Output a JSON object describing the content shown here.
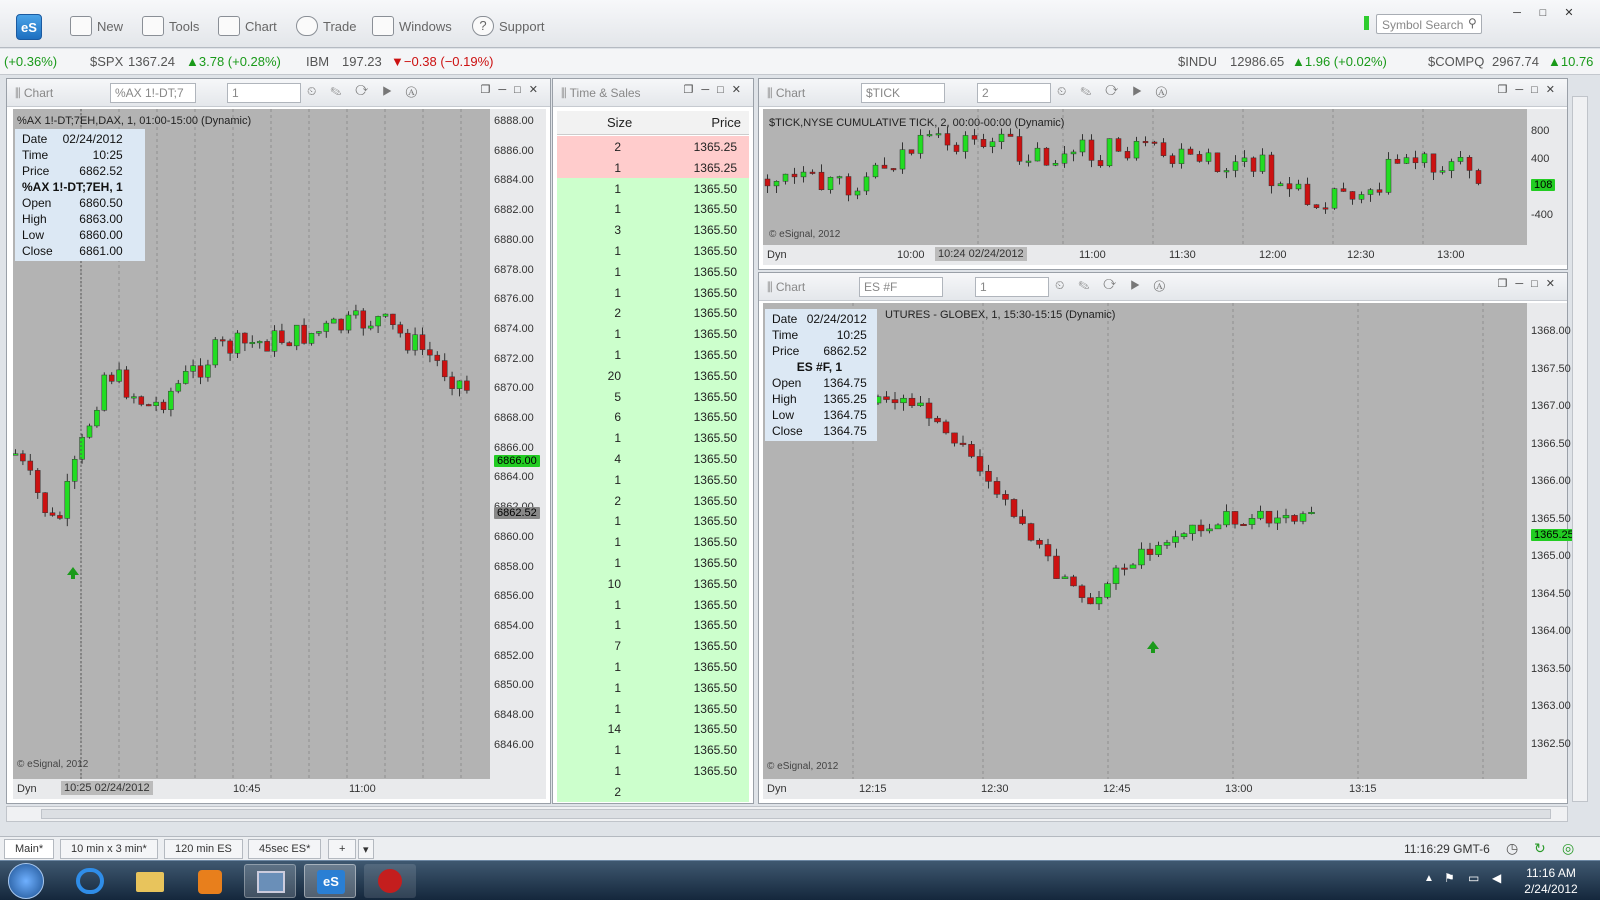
{
  "app": {
    "logo": "eS",
    "toolbar": [
      {
        "label": "New",
        "icon": "new-window-icon"
      },
      {
        "label": "Tools",
        "icon": "tools-icon"
      },
      {
        "label": "Chart",
        "icon": "chart-icon"
      },
      {
        "label": "Trade",
        "icon": "trade-icon"
      },
      {
        "label": "Windows",
        "icon": "windows-icon"
      },
      {
        "label": "Support",
        "icon": "help-icon"
      }
    ],
    "symbol_search_placeholder": "Symbol Search"
  },
  "ticker": [
    {
      "text": "(+0.36%)",
      "cls": "up"
    },
    {
      "sym": "$SPX",
      "price": "1367.24",
      "change": "▲3.78 (+0.28%)",
      "cls": "up"
    },
    {
      "sym": "IBM",
      "price": "197.23",
      "change": "▼−0.38 (−0.19%)",
      "cls": "dn"
    },
    {
      "sym": "$INDU",
      "price": "12986.65",
      "change": "▲1.96 (+0.02%)",
      "cls": "up"
    },
    {
      "sym": "$COMPQ",
      "price": "2967.74",
      "change": "▲10.76",
      "cls": "up"
    }
  ],
  "chart1": {
    "title": "Chart",
    "symbol": "%AX 1!-DT;7",
    "interval": "1",
    "caption": "%AX 1!-DT;7EH,DAX, 1, 01:00-15:00 (Dynamic)",
    "info": {
      "date": "02/24/2012",
      "time": "10:25",
      "price": "6862.52",
      "symbol": "%AX 1!-DT;7EH, 1",
      "open": "6860.50",
      "high": "6863.00",
      "low": "6860.00",
      "close": "6861.00"
    },
    "yticks": [
      "6888.00",
      "6886.00",
      "6884.00",
      "6882.00",
      "6880.00",
      "6878.00",
      "6876.00",
      "6874.00",
      "6872.00",
      "6870.00",
      "6868.00",
      "6866.00",
      "6864.00",
      "6862.00",
      "6860.00",
      "6858.00",
      "6856.00",
      "6854.00",
      "6852.00",
      "6850.00",
      "6848.00",
      "6846.00"
    ],
    "last_price": "6866.00",
    "cursor_price": "6862.52",
    "dyn": "Dyn",
    "cursor_time": "10:25 02/24/2012",
    "xticks": [
      "10:45",
      "11:00"
    ],
    "copyright": "© eSignal, 2012"
  },
  "ts": {
    "title": "Time & Sales",
    "col_size": "Size",
    "col_price": "Price",
    "rows": [
      [
        "2",
        "1365.25",
        "dn"
      ],
      [
        "1",
        "1365.25",
        "dn"
      ],
      [
        "1",
        "1365.50",
        "up"
      ],
      [
        "1",
        "1365.50",
        "up"
      ],
      [
        "3",
        "1365.50",
        "up"
      ],
      [
        "1",
        "1365.50",
        "up"
      ],
      [
        "1",
        "1365.50",
        "up"
      ],
      [
        "1",
        "1365.50",
        "up"
      ],
      [
        "2",
        "1365.50",
        "up"
      ],
      [
        "1",
        "1365.50",
        "up"
      ],
      [
        "1",
        "1365.50",
        "up"
      ],
      [
        "20",
        "1365.50",
        "up"
      ],
      [
        "5",
        "1365.50",
        "up"
      ],
      [
        "6",
        "1365.50",
        "up"
      ],
      [
        "1",
        "1365.50",
        "up"
      ],
      [
        "4",
        "1365.50",
        "up"
      ],
      [
        "1",
        "1365.50",
        "up"
      ],
      [
        "2",
        "1365.50",
        "up"
      ],
      [
        "1",
        "1365.50",
        "up"
      ],
      [
        "1",
        "1365.50",
        "up"
      ],
      [
        "1",
        "1365.50",
        "up"
      ],
      [
        "10",
        "1365.50",
        "up"
      ],
      [
        "1",
        "1365.50",
        "up"
      ],
      [
        "1",
        "1365.50",
        "up"
      ],
      [
        "7",
        "1365.50",
        "up"
      ],
      [
        "1",
        "1365.50",
        "up"
      ],
      [
        "1",
        "1365.50",
        "up"
      ],
      [
        "1",
        "1365.50",
        "up"
      ],
      [
        "14",
        "1365.50",
        "up"
      ],
      [
        "1",
        "1365.50",
        "up"
      ],
      [
        "1",
        "1365.50",
        "up"
      ],
      [
        "2",
        "",
        "up"
      ]
    ]
  },
  "chart2": {
    "title": "Chart",
    "symbol": "$TICK",
    "interval": "2",
    "caption": "$TICK,NYSE CUMULATIVE TICK, 2, 00:00-00:00 (Dynamic)",
    "yticks": [
      "800",
      "400",
      "0",
      "-400"
    ],
    "last": "108",
    "dyn": "Dyn",
    "cursor_time": "10:24 02/24/2012",
    "xticks": [
      "10:00",
      "11:00",
      "11:30",
      "12:00",
      "12:30",
      "13:00"
    ],
    "copyright": "© eSignal, 2012"
  },
  "chart3": {
    "title": "Chart",
    "symbol": "ES #F",
    "interval": "1",
    "caption": "UTURES - GLOBEX, 1, 15:30-15:15 (Dynamic)",
    "info": {
      "date": "02/24/2012",
      "time": "10:25",
      "price": "6862.52",
      "symbol": "ES #F, 1",
      "open": "1364.75",
      "high": "1365.25",
      "low": "1364.75",
      "close": "1364.75"
    },
    "yticks": [
      "1368.00",
      "1367.50",
      "1367.00",
      "1366.50",
      "1366.00",
      "1365.50",
      "1365.00",
      "1364.50",
      "1364.00",
      "1363.50",
      "1363.00",
      "1362.50"
    ],
    "last": "1365.25",
    "dyn": "Dyn",
    "xticks": [
      "12:15",
      "12:30",
      "12:45",
      "13:00",
      "13:15"
    ],
    "copyright": "© eSignal, 2012"
  },
  "tabs": [
    "Main*",
    "10 min x 3 min*",
    "120 min ES",
    "45sec ES*",
    "+"
  ],
  "status": {
    "clock": "11:16:29 GMT-6"
  },
  "taskbar": {
    "time": "11:16 AM",
    "date": "2/24/2012"
  },
  "colors": {
    "up": "#22dd22",
    "down": "#cc1111",
    "band": "#5f9fd6",
    "chart_bg": "#b3b3b3",
    "ts_up": "#ccffcc",
    "ts_dn": "#ffcccc"
  }
}
